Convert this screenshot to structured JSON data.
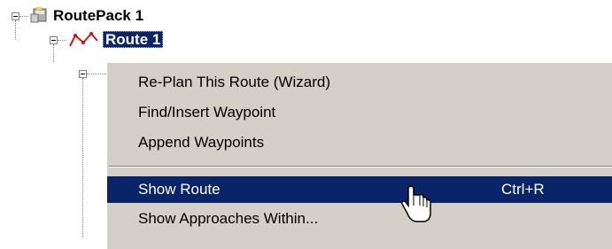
{
  "tree": {
    "routepack": {
      "label": "RoutePack 1",
      "icon": "routepack-icon"
    },
    "route": {
      "label": "Route 1",
      "icon": "route-icon",
      "selected": true
    }
  },
  "context_menu": {
    "items": [
      {
        "label": "Re-Plan This Route (Wizard)",
        "shortcut": ""
      },
      {
        "label": "Find/Insert Waypoint",
        "shortcut": ""
      },
      {
        "label": "Append Waypoints",
        "shortcut": ""
      },
      {
        "label": "Show Route",
        "shortcut": "Ctrl+R",
        "highlighted": true
      },
      {
        "label": "Show Approaches Within...",
        "shortcut": ""
      }
    ]
  },
  "colors": {
    "selection": "#0a246a",
    "menu_background": "#d4d0c8"
  }
}
